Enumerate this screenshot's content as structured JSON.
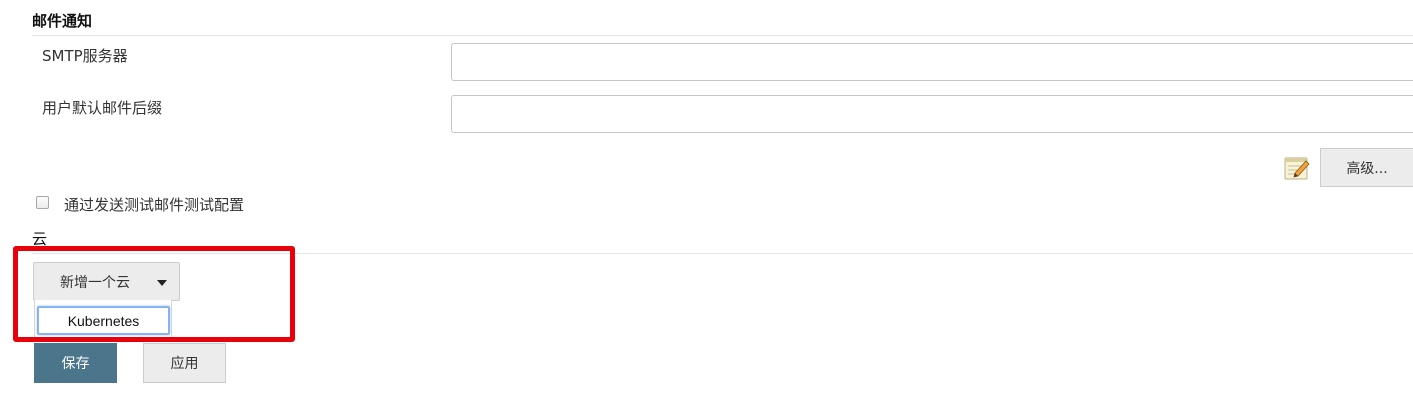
{
  "email_section": {
    "title": "邮件通知",
    "smtp_label": "SMTP服务器",
    "smtp_value": "",
    "suffix_label": "用户默认邮件后缀",
    "suffix_value": "",
    "advanced_button": "高级...",
    "advanced_icon": "notepad-pencil-icon",
    "test_checkbox_label": "通过发送测试邮件测试配置",
    "test_checkbox_checked": false
  },
  "cloud_section": {
    "title": "云",
    "add_cloud_button": "新增一个云",
    "dropdown_options": [
      "Kubernetes"
    ],
    "highlight_color": "#e8000b"
  },
  "footer": {
    "save_button": "保存",
    "apply_button": "应用",
    "save_color": "#4b758b"
  }
}
